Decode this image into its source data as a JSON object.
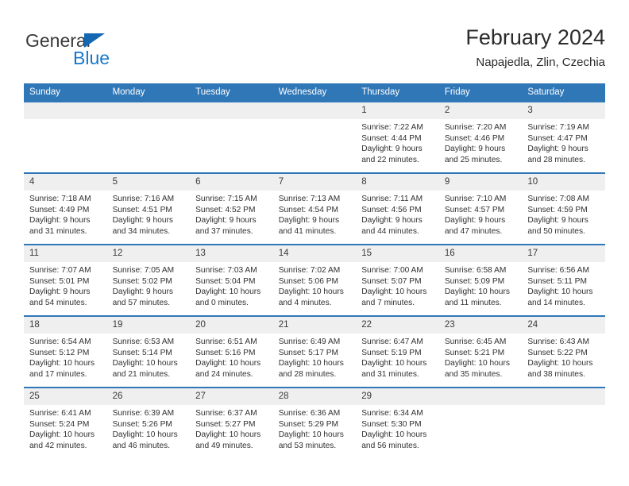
{
  "brand": {
    "name_part1": "General",
    "name_part2": "Blue",
    "triangle_color": "#1567b2",
    "blue_color": "#1878c8"
  },
  "header": {
    "title": "February 2024",
    "subtitle": "Napajedla, Zlin, Czechia"
  },
  "theme": {
    "header_bg": "#3077b8",
    "header_text": "#ffffff",
    "row_border": "#2f77b8",
    "daynum_bg": "#efefef",
    "body_text": "#303030"
  },
  "weekday_headers": [
    "Sunday",
    "Monday",
    "Tuesday",
    "Wednesday",
    "Thursday",
    "Friday",
    "Saturday"
  ],
  "weeks": [
    [
      {
        "day": "",
        "sunrise": "",
        "sunset": "",
        "daylight_line1": "",
        "daylight_line2": ""
      },
      {
        "day": "",
        "sunrise": "",
        "sunset": "",
        "daylight_line1": "",
        "daylight_line2": ""
      },
      {
        "day": "",
        "sunrise": "",
        "sunset": "",
        "daylight_line1": "",
        "daylight_line2": ""
      },
      {
        "day": "",
        "sunrise": "",
        "sunset": "",
        "daylight_line1": "",
        "daylight_line2": ""
      },
      {
        "day": "1",
        "sunrise": "Sunrise: 7:22 AM",
        "sunset": "Sunset: 4:44 PM",
        "daylight_line1": "Daylight: 9 hours",
        "daylight_line2": "and 22 minutes."
      },
      {
        "day": "2",
        "sunrise": "Sunrise: 7:20 AM",
        "sunset": "Sunset: 4:46 PM",
        "daylight_line1": "Daylight: 9 hours",
        "daylight_line2": "and 25 minutes."
      },
      {
        "day": "3",
        "sunrise": "Sunrise: 7:19 AM",
        "sunset": "Sunset: 4:47 PM",
        "daylight_line1": "Daylight: 9 hours",
        "daylight_line2": "and 28 minutes."
      }
    ],
    [
      {
        "day": "4",
        "sunrise": "Sunrise: 7:18 AM",
        "sunset": "Sunset: 4:49 PM",
        "daylight_line1": "Daylight: 9 hours",
        "daylight_line2": "and 31 minutes."
      },
      {
        "day": "5",
        "sunrise": "Sunrise: 7:16 AM",
        "sunset": "Sunset: 4:51 PM",
        "daylight_line1": "Daylight: 9 hours",
        "daylight_line2": "and 34 minutes."
      },
      {
        "day": "6",
        "sunrise": "Sunrise: 7:15 AM",
        "sunset": "Sunset: 4:52 PM",
        "daylight_line1": "Daylight: 9 hours",
        "daylight_line2": "and 37 minutes."
      },
      {
        "day": "7",
        "sunrise": "Sunrise: 7:13 AM",
        "sunset": "Sunset: 4:54 PM",
        "daylight_line1": "Daylight: 9 hours",
        "daylight_line2": "and 41 minutes."
      },
      {
        "day": "8",
        "sunrise": "Sunrise: 7:11 AM",
        "sunset": "Sunset: 4:56 PM",
        "daylight_line1": "Daylight: 9 hours",
        "daylight_line2": "and 44 minutes."
      },
      {
        "day": "9",
        "sunrise": "Sunrise: 7:10 AM",
        "sunset": "Sunset: 4:57 PM",
        "daylight_line1": "Daylight: 9 hours",
        "daylight_line2": "and 47 minutes."
      },
      {
        "day": "10",
        "sunrise": "Sunrise: 7:08 AM",
        "sunset": "Sunset: 4:59 PM",
        "daylight_line1": "Daylight: 9 hours",
        "daylight_line2": "and 50 minutes."
      }
    ],
    [
      {
        "day": "11",
        "sunrise": "Sunrise: 7:07 AM",
        "sunset": "Sunset: 5:01 PM",
        "daylight_line1": "Daylight: 9 hours",
        "daylight_line2": "and 54 minutes."
      },
      {
        "day": "12",
        "sunrise": "Sunrise: 7:05 AM",
        "sunset": "Sunset: 5:02 PM",
        "daylight_line1": "Daylight: 9 hours",
        "daylight_line2": "and 57 minutes."
      },
      {
        "day": "13",
        "sunrise": "Sunrise: 7:03 AM",
        "sunset": "Sunset: 5:04 PM",
        "daylight_line1": "Daylight: 10 hours",
        "daylight_line2": "and 0 minutes."
      },
      {
        "day": "14",
        "sunrise": "Sunrise: 7:02 AM",
        "sunset": "Sunset: 5:06 PM",
        "daylight_line1": "Daylight: 10 hours",
        "daylight_line2": "and 4 minutes."
      },
      {
        "day": "15",
        "sunrise": "Sunrise: 7:00 AM",
        "sunset": "Sunset: 5:07 PM",
        "daylight_line1": "Daylight: 10 hours",
        "daylight_line2": "and 7 minutes."
      },
      {
        "day": "16",
        "sunrise": "Sunrise: 6:58 AM",
        "sunset": "Sunset: 5:09 PM",
        "daylight_line1": "Daylight: 10 hours",
        "daylight_line2": "and 11 minutes."
      },
      {
        "day": "17",
        "sunrise": "Sunrise: 6:56 AM",
        "sunset": "Sunset: 5:11 PM",
        "daylight_line1": "Daylight: 10 hours",
        "daylight_line2": "and 14 minutes."
      }
    ],
    [
      {
        "day": "18",
        "sunrise": "Sunrise: 6:54 AM",
        "sunset": "Sunset: 5:12 PM",
        "daylight_line1": "Daylight: 10 hours",
        "daylight_line2": "and 17 minutes."
      },
      {
        "day": "19",
        "sunrise": "Sunrise: 6:53 AM",
        "sunset": "Sunset: 5:14 PM",
        "daylight_line1": "Daylight: 10 hours",
        "daylight_line2": "and 21 minutes."
      },
      {
        "day": "20",
        "sunrise": "Sunrise: 6:51 AM",
        "sunset": "Sunset: 5:16 PM",
        "daylight_line1": "Daylight: 10 hours",
        "daylight_line2": "and 24 minutes."
      },
      {
        "day": "21",
        "sunrise": "Sunrise: 6:49 AM",
        "sunset": "Sunset: 5:17 PM",
        "daylight_line1": "Daylight: 10 hours",
        "daylight_line2": "and 28 minutes."
      },
      {
        "day": "22",
        "sunrise": "Sunrise: 6:47 AM",
        "sunset": "Sunset: 5:19 PM",
        "daylight_line1": "Daylight: 10 hours",
        "daylight_line2": "and 31 minutes."
      },
      {
        "day": "23",
        "sunrise": "Sunrise: 6:45 AM",
        "sunset": "Sunset: 5:21 PM",
        "daylight_line1": "Daylight: 10 hours",
        "daylight_line2": "and 35 minutes."
      },
      {
        "day": "24",
        "sunrise": "Sunrise: 6:43 AM",
        "sunset": "Sunset: 5:22 PM",
        "daylight_line1": "Daylight: 10 hours",
        "daylight_line2": "and 38 minutes."
      }
    ],
    [
      {
        "day": "25",
        "sunrise": "Sunrise: 6:41 AM",
        "sunset": "Sunset: 5:24 PM",
        "daylight_line1": "Daylight: 10 hours",
        "daylight_line2": "and 42 minutes."
      },
      {
        "day": "26",
        "sunrise": "Sunrise: 6:39 AM",
        "sunset": "Sunset: 5:26 PM",
        "daylight_line1": "Daylight: 10 hours",
        "daylight_line2": "and 46 minutes."
      },
      {
        "day": "27",
        "sunrise": "Sunrise: 6:37 AM",
        "sunset": "Sunset: 5:27 PM",
        "daylight_line1": "Daylight: 10 hours",
        "daylight_line2": "and 49 minutes."
      },
      {
        "day": "28",
        "sunrise": "Sunrise: 6:36 AM",
        "sunset": "Sunset: 5:29 PM",
        "daylight_line1": "Daylight: 10 hours",
        "daylight_line2": "and 53 minutes."
      },
      {
        "day": "29",
        "sunrise": "Sunrise: 6:34 AM",
        "sunset": "Sunset: 5:30 PM",
        "daylight_line1": "Daylight: 10 hours",
        "daylight_line2": "and 56 minutes."
      },
      {
        "day": "",
        "sunrise": "",
        "sunset": "",
        "daylight_line1": "",
        "daylight_line2": ""
      },
      {
        "day": "",
        "sunrise": "",
        "sunset": "",
        "daylight_line1": "",
        "daylight_line2": ""
      }
    ]
  ]
}
